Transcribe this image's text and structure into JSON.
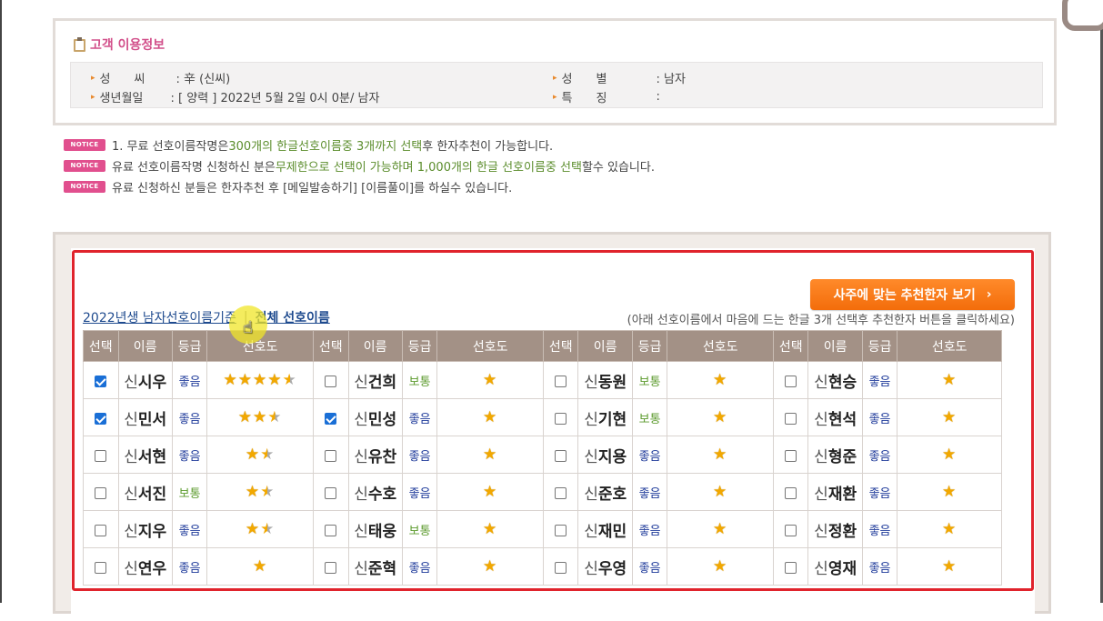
{
  "info": {
    "title": "고객 이용정보",
    "surname_label": "성　　씨",
    "surname_value": ": 辛 (신씨)",
    "birth_label": "생년월일",
    "birth_value": ": [ 양력 ] 2022년 5월 2일 0시 0분/ 남자",
    "gender_label": "성　　별",
    "gender_value": ": 남자",
    "feature_label": "특　　징",
    "feature_value": ":"
  },
  "notices": {
    "badge": "NOTICE",
    "n1": [
      "1. 무료 선호이름작명은 ",
      "300개의 한글선호이름중 3개까지 선택",
      "후 한자추천이 가능합니다."
    ],
    "n2": [
      "유료 선호이름작명 신청하신 분은",
      "무제한으로 선택이 가능하며 1,000개의 한글 선호이름중 선택",
      "할수 있습니다."
    ],
    "n3": "유료 신청하신 분들은 한자추천 후 [메일발송하기] [이름풀이]를 하실수 있습니다."
  },
  "cta_label": "사주에 맞는 추천한자 보기",
  "links": {
    "link1": "2022년생 남자선호이름기준",
    "sep": "|",
    "link2": "전체 선호이름",
    "hint": "(아래 선호이름에서 마음에 드는 한글 3개 선택후 추천한자 버튼을 클릭하세요)"
  },
  "headers": [
    "선택",
    "이름",
    "등급",
    "선호도"
  ],
  "surname": "신",
  "rows": [
    [
      {
        "g": "시우",
        "c": true,
        "grade": "좋음",
        "s": 5
      },
      {
        "g": "건희",
        "c": false,
        "grade": "보통",
        "s": 1
      },
      {
        "g": "동원",
        "c": false,
        "grade": "보통",
        "s": 1
      },
      {
        "g": "현승",
        "c": false,
        "grade": "좋음",
        "s": 1
      }
    ],
    [
      {
        "g": "민서",
        "c": true,
        "grade": "좋음",
        "s": 3
      },
      {
        "g": "민성",
        "c": true,
        "grade": "좋음",
        "s": 1
      },
      {
        "g": "기현",
        "c": false,
        "grade": "보통",
        "s": 1
      },
      {
        "g": "현석",
        "c": false,
        "grade": "좋음",
        "s": 1
      }
    ],
    [
      {
        "g": "서현",
        "c": false,
        "grade": "좋음",
        "s": 2
      },
      {
        "g": "유찬",
        "c": false,
        "grade": "좋음",
        "s": 1
      },
      {
        "g": "지용",
        "c": false,
        "grade": "좋음",
        "s": 1
      },
      {
        "g": "형준",
        "c": false,
        "grade": "좋음",
        "s": 1
      }
    ],
    [
      {
        "g": "서진",
        "c": false,
        "grade": "보통",
        "s": 2
      },
      {
        "g": "수호",
        "c": false,
        "grade": "좋음",
        "s": 1
      },
      {
        "g": "준호",
        "c": false,
        "grade": "좋음",
        "s": 1
      },
      {
        "g": "재환",
        "c": false,
        "grade": "좋음",
        "s": 1
      }
    ],
    [
      {
        "g": "지우",
        "c": false,
        "grade": "좋음",
        "s": 2
      },
      {
        "g": "태웅",
        "c": false,
        "grade": "보통",
        "s": 1
      },
      {
        "g": "재민",
        "c": false,
        "grade": "좋음",
        "s": 1
      },
      {
        "g": "정환",
        "c": false,
        "grade": "좋음",
        "s": 1
      }
    ],
    [
      {
        "g": "연우",
        "c": false,
        "grade": "좋음",
        "s": 1
      },
      {
        "g": "준혁",
        "c": false,
        "grade": "좋음",
        "s": 1
      },
      {
        "g": "우영",
        "c": false,
        "grade": "좋음",
        "s": 1
      },
      {
        "g": "영재",
        "c": false,
        "grade": "좋음",
        "s": 1
      }
    ]
  ],
  "colors": {
    "accent_pink": "#d24f8a",
    "accent_orange": "#f36d0b",
    "header_bg": "#a39186",
    "highlight_red": "#e0232c"
  }
}
